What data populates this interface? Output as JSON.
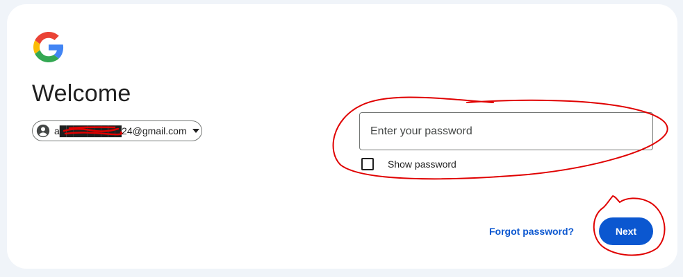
{
  "colors": {
    "page_bg": "#f0f4f9",
    "card_bg": "#ffffff",
    "primary": "#0b57d0",
    "text": "#1f1f1f",
    "annotation": "#e00000"
  },
  "logo": {
    "icon": "google-g-icon"
  },
  "heading": {
    "title": "Welcome"
  },
  "account": {
    "email": "a█████████24@gmail.com",
    "avatar_icon": "account-circle-icon",
    "dropdown_icon": "caret-down-icon"
  },
  "password": {
    "placeholder": "Enter your password",
    "value": ""
  },
  "show_password": {
    "label": "Show password",
    "checked": false
  },
  "actions": {
    "forgot_label": "Forgot password?",
    "next_label": "Next"
  }
}
